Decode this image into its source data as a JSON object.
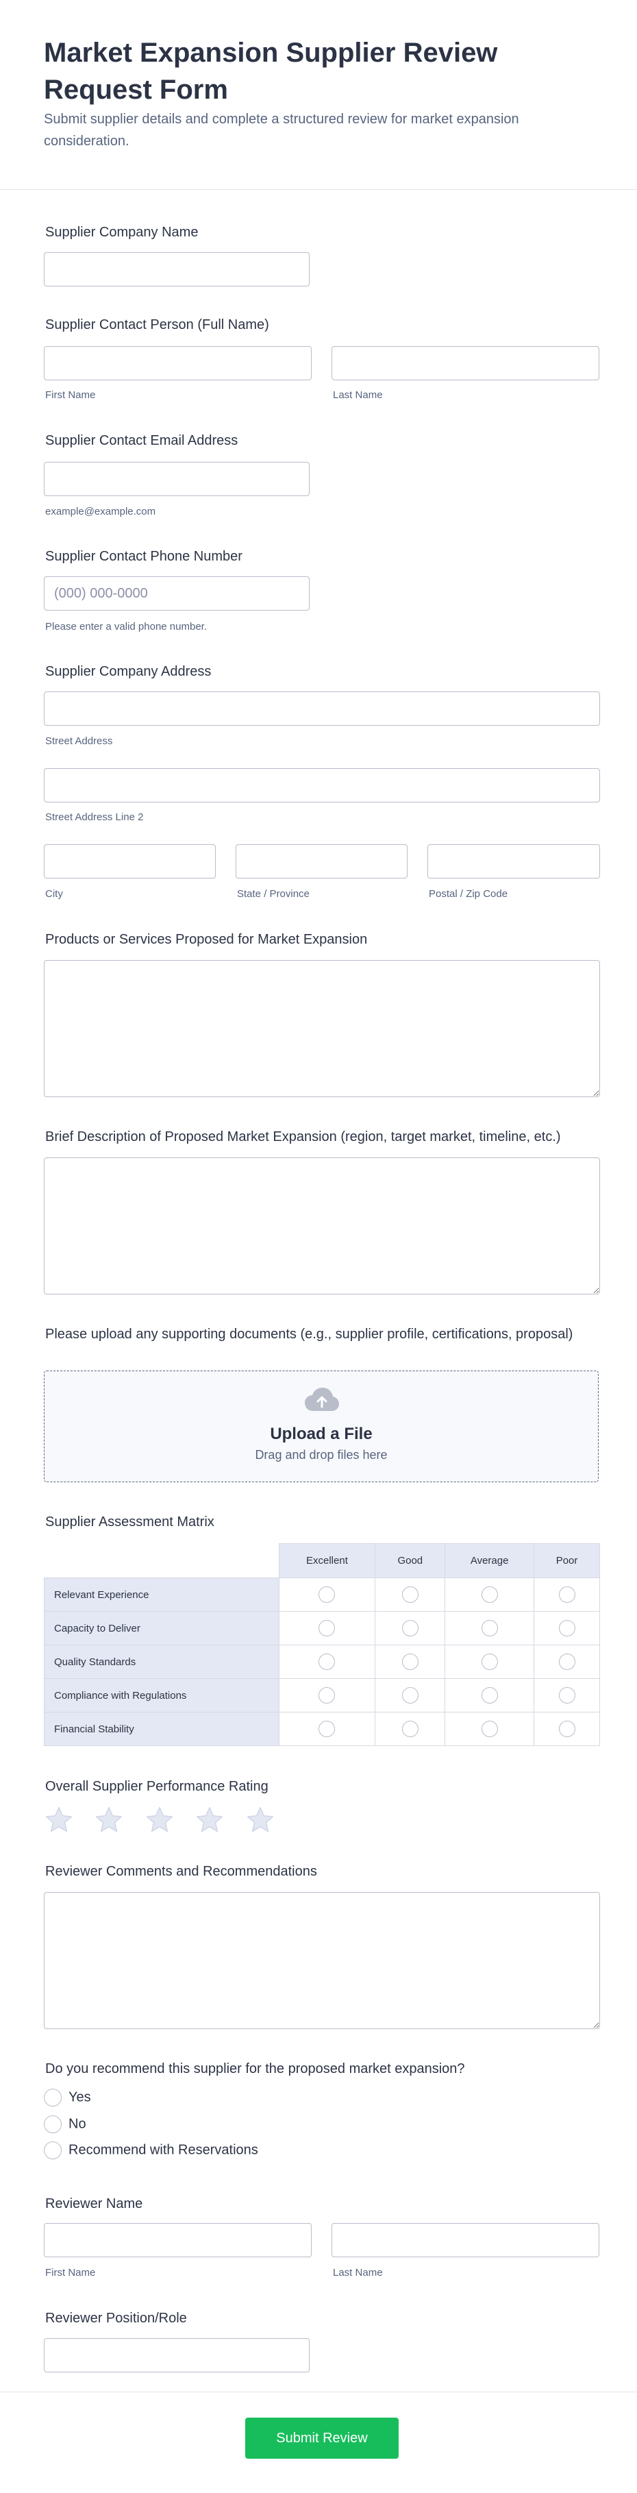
{
  "header": {
    "title": "Market Expansion Supplier Review Request Form",
    "subtitle": "Submit supplier details and complete a structured review for market expansion consideration."
  },
  "fields": {
    "company_name": {
      "label": "Supplier Company Name",
      "value": ""
    },
    "contact_person": {
      "label": "Supplier Contact Person (Full Name)",
      "first_sublabel": "First Name",
      "last_sublabel": "Last Name"
    },
    "email": {
      "label": "Supplier Contact Email Address",
      "sublabel": "example@example.com"
    },
    "phone": {
      "label": "Supplier Contact Phone Number",
      "placeholder": "(000) 000-0000",
      "sublabel": "Please enter a valid phone number."
    },
    "address": {
      "label": "Supplier Company Address",
      "street_sublabel": "Street Address",
      "street2_sublabel": "Street Address Line 2",
      "city_sublabel": "City",
      "state_sublabel": "State / Province",
      "zip_sublabel": "Postal / Zip Code"
    },
    "products": {
      "label": "Products or Services Proposed for Market Expansion"
    },
    "description": {
      "label": "Brief Description of Proposed Market Expansion (region, target market, timeline, etc.)"
    },
    "upload": {
      "label": "Please upload any supporting documents (e.g., supplier profile, certifications, proposal)",
      "title": "Upload a File",
      "subtitle": "Drag and drop files here",
      "icon": "cloud-upload-icon"
    },
    "matrix": {
      "label": "Supplier Assessment Matrix",
      "columns": [
        "Excellent",
        "Good",
        "Average",
        "Poor"
      ],
      "rows": [
        "Relevant Experience",
        "Capacity to Deliver",
        "Quality Standards",
        "Compliance with Regulations",
        "Financial Stability"
      ]
    },
    "rating": {
      "label": "Overall Supplier Performance Rating",
      "max": 5,
      "value": 0,
      "icon": "star-icon"
    },
    "comments": {
      "label": "Reviewer Comments and Recommendations"
    },
    "recommend": {
      "label": "Do you recommend this supplier for the proposed market expansion?",
      "options": [
        "Yes",
        "No",
        "Recommend with Reservations"
      ]
    },
    "reviewer_name": {
      "label": "Reviewer Name",
      "first_sublabel": "First Name",
      "last_sublabel": "Last Name"
    },
    "reviewer_role": {
      "label": "Reviewer Position/Role"
    }
  },
  "submit": {
    "label": "Submit Review"
  },
  "colors": {
    "accent": "#18bd5b",
    "text": "#2c3345",
    "muted": "#57647e",
    "border": "#b8bdc9",
    "matrix_header": "#e4e8f4"
  }
}
